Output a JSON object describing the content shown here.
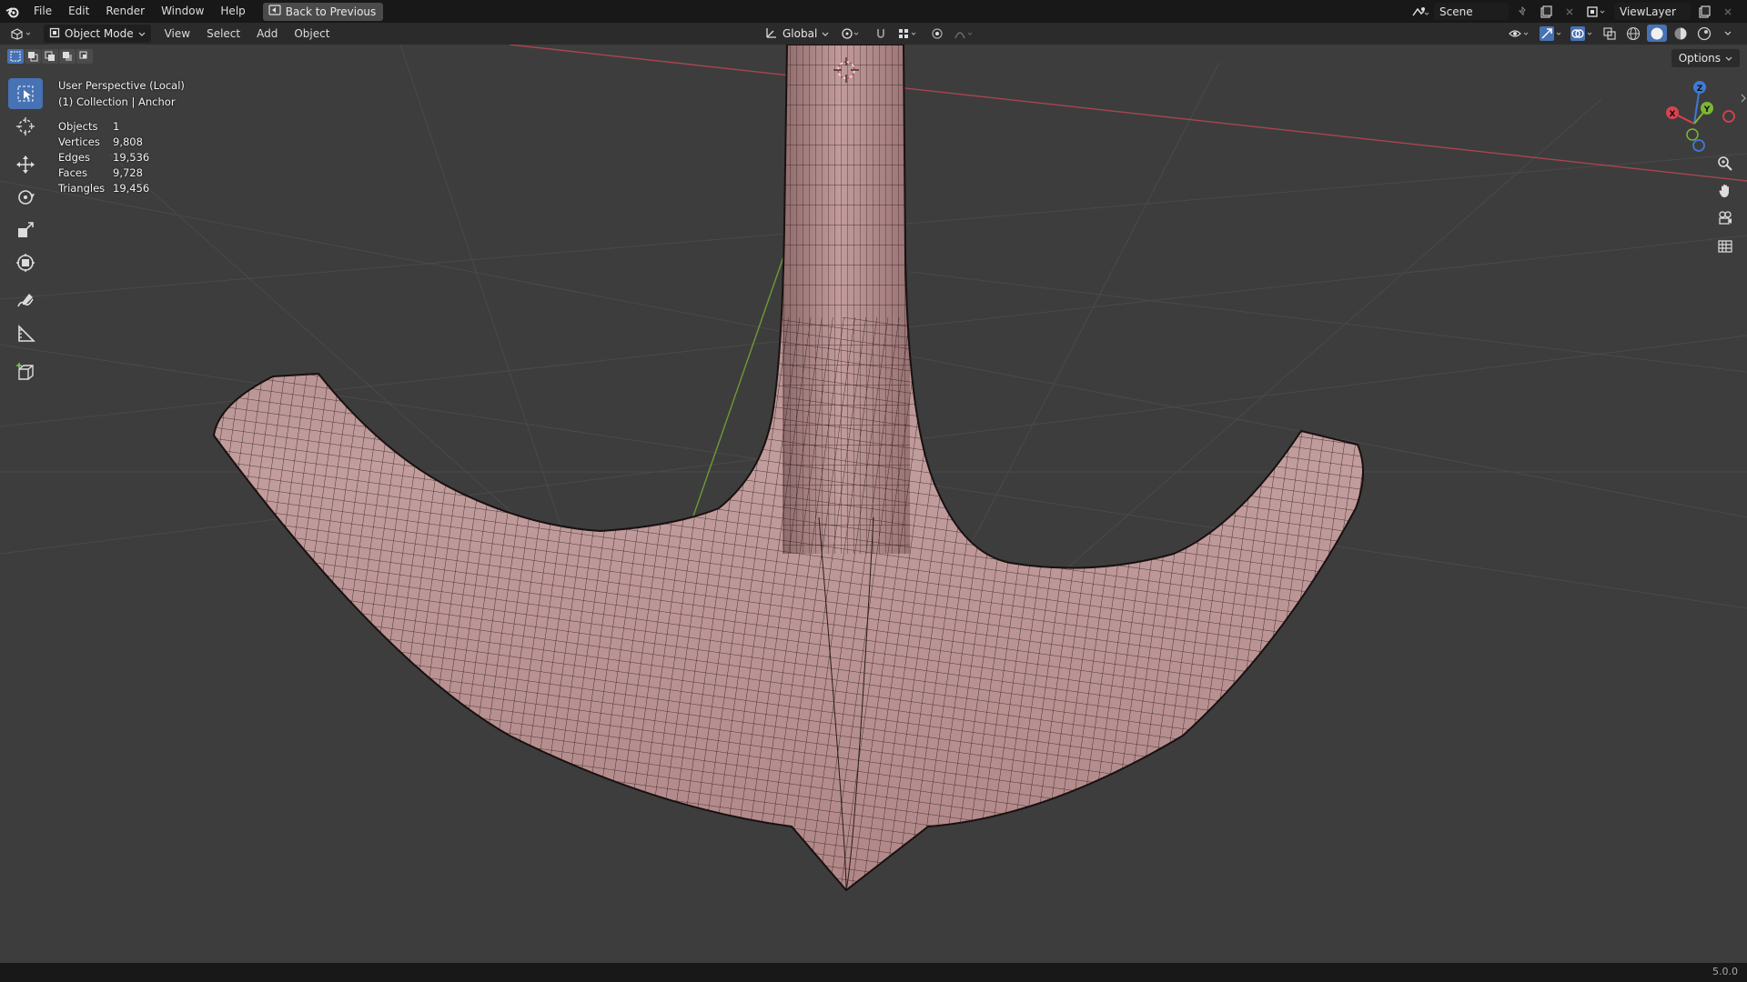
{
  "topbar": {
    "menus": [
      "File",
      "Edit",
      "Render",
      "Window",
      "Help"
    ],
    "back_label": "Back to Previous",
    "scene": "Scene",
    "view_layer": "ViewLayer"
  },
  "header": {
    "mode": "Object Mode",
    "menus": [
      "View",
      "Select",
      "Add",
      "Object"
    ],
    "transform_orientation": "Global"
  },
  "viewport": {
    "perspective": "User Perspective (Local)",
    "collection": "(1) Collection | Anchor",
    "stats": [
      {
        "label": "Objects",
        "value": "1"
      },
      {
        "label": "Vertices",
        "value": "9,808"
      },
      {
        "label": "Edges",
        "value": "19,536"
      },
      {
        "label": "Faces",
        "value": "9,728"
      },
      {
        "label": "Triangles",
        "value": "19,456"
      }
    ],
    "options_label": "Options"
  },
  "gizmo": {
    "x": "X",
    "y": "Y",
    "z": "Z"
  },
  "status": {
    "version": "5.0.0"
  },
  "colors": {
    "mesh": "#b4888a",
    "wire": "#201616",
    "x_axis": "#d9424f",
    "y_axis": "#7bb734",
    "z_axis": "#3e7ad8",
    "active": "#4772b3"
  },
  "icons": {
    "tools": [
      "select-box-icon",
      "cursor-icon",
      "move-icon",
      "rotate-icon",
      "scale-icon",
      "transform-icon",
      "annotate-icon",
      "measure-icon",
      "add-cube-icon"
    ]
  }
}
